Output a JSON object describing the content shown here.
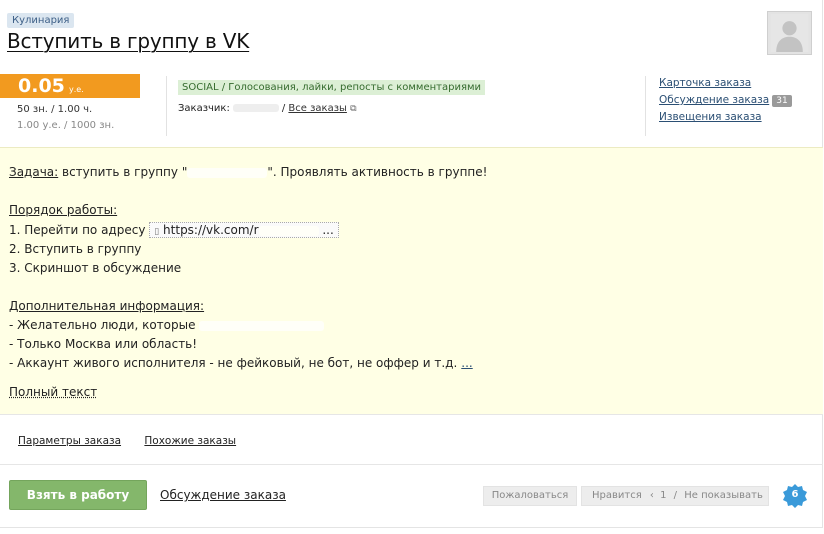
{
  "header": {
    "category": "Кулинария",
    "title": "Вступить в группу в VK"
  },
  "price": {
    "value": "0.05",
    "unit": "у.е.",
    "line1": "50 зн. / 1.00 ч.",
    "line2": "1.00 у.е. / 1000 зн."
  },
  "order": {
    "tag": "SOCIAL / Голосования, лайки, репосты с комментариями",
    "customer_label": "Заказчик:",
    "all_orders": "Все заказы"
  },
  "side_links": {
    "card": "Карточка заказа",
    "discussion": "Обсуждение заказа",
    "discussion_count": "31",
    "notices": "Извещения заказа"
  },
  "task": {
    "task_label": "Задача:",
    "task_text_before": "вступить в группу \"",
    "task_text_after": "\". Проявлять активность в группе!",
    "order_label": "Порядок работы:",
    "step1_prefix": "1. Перейти по адресу",
    "step1_url": "https://vk.com/r",
    "step1_ellipsis": "...",
    "step2": "2. Вступить в группу",
    "step3": "3. Скриншот в обсуждение",
    "extra_label": "Дополнительная информация:",
    "extra1_prefix": "- Желательно люди, которые",
    "extra2": "- Только Москва или область!",
    "extra3": "- Аккаунт живого исполнителя - не фейковый, не бот, не оффер и т.д.",
    "more_link": "...",
    "full_text": "Полный текст"
  },
  "tabs": [
    "Параметры заказа",
    "Похожие заказы"
  ],
  "footer": {
    "take_button": "Взять в работу",
    "discussion_link": "Обсуждение заказа",
    "complain": "Пожаловаться",
    "like": "Нравится",
    "like_count": "1",
    "hide": "Не показывать",
    "notification_count": "6"
  },
  "colors": {
    "price_bg": "#f29a1f",
    "task_bg": "#ffffe5",
    "button_green": "#84b76b",
    "link_blue": "#2b4f74",
    "badge_blue": "#3a9ad9"
  }
}
